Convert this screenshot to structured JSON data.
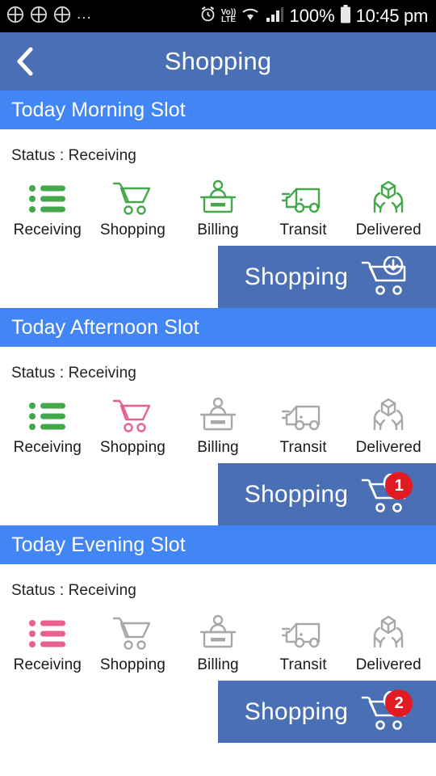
{
  "status_bar": {
    "notification_icons": [
      "app-notification-icon",
      "app-notification-icon",
      "app-notification-icon"
    ],
    "overflow": "...",
    "icons_right": [
      "alarm-icon",
      "volte-icon",
      "wifi-icon",
      "signal-icon",
      "battery-icon"
    ],
    "volte_top": "Vo))",
    "volte_bottom": "LTE",
    "battery_percent": "100%",
    "time": "10:45 pm"
  },
  "app_bar": {
    "back_label": "‹",
    "title": "Shopping"
  },
  "colors": {
    "appbar_blue": "#4a6fb5",
    "section_blue": "#4285f4",
    "active_green": "#43a84a",
    "active_pink": "#e8618c",
    "inactive_gray": "#a8a8a8",
    "badge_red": "#e21b22"
  },
  "step_labels": [
    "Receiving",
    "Shopping",
    "Billing",
    "Transit",
    "Delivered"
  ],
  "step_icons": [
    "list-icon",
    "cart-icon",
    "billing-counter-icon",
    "truck-icon",
    "hands-package-icon"
  ],
  "slots": [
    {
      "title": "Today Morning Slot",
      "status": "Status : Receiving",
      "steps": [
        {
          "label": "Receiving",
          "state": "green"
        },
        {
          "label": "Shopping",
          "state": "green"
        },
        {
          "label": "Billing",
          "state": "green"
        },
        {
          "label": "Transit",
          "state": "green"
        },
        {
          "label": "Delivered",
          "state": "green"
        }
      ],
      "action": {
        "label": "Shopping",
        "icon": "cart-download-icon",
        "badge": ""
      }
    },
    {
      "title": "Today Afternoon Slot",
      "status": "Status : Receiving",
      "steps": [
        {
          "label": "Receiving",
          "state": "green"
        },
        {
          "label": "Shopping",
          "state": "pink"
        },
        {
          "label": "Billing",
          "state": "gray"
        },
        {
          "label": "Transit",
          "state": "gray"
        },
        {
          "label": "Delivered",
          "state": "gray"
        }
      ],
      "action": {
        "label": "Shopping",
        "icon": "cart-download-icon",
        "badge": "1"
      }
    },
    {
      "title": "Today Evening Slot",
      "status": "Status : Receiving",
      "steps": [
        {
          "label": "Receiving",
          "state": "pink"
        },
        {
          "label": "Shopping",
          "state": "gray"
        },
        {
          "label": "Billing",
          "state": "gray"
        },
        {
          "label": "Transit",
          "state": "gray"
        },
        {
          "label": "Delivered",
          "state": "gray"
        }
      ],
      "action": {
        "label": "Shopping",
        "icon": "cart-download-icon",
        "badge": "2"
      }
    }
  ]
}
